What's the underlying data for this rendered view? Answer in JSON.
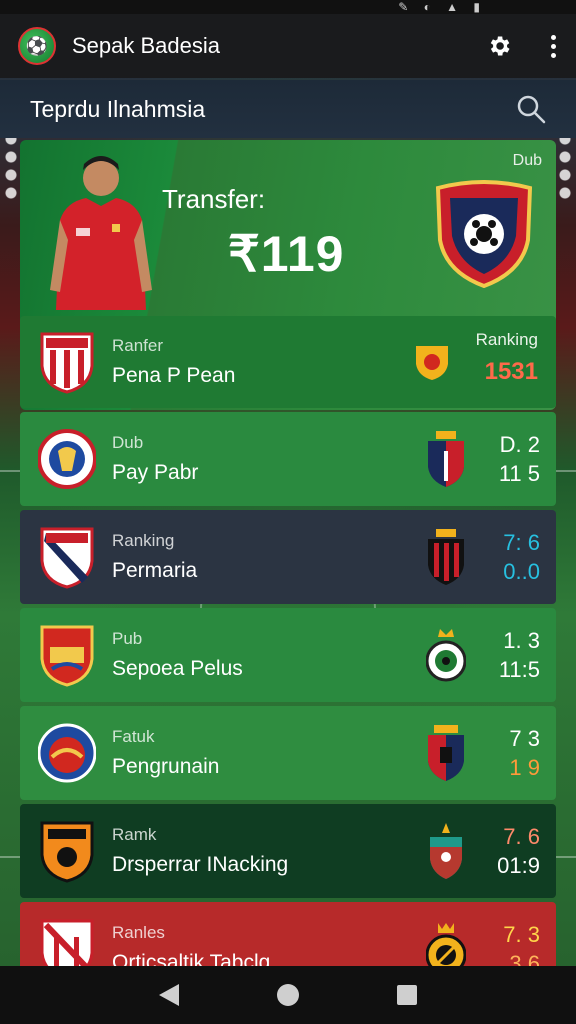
{
  "app": {
    "title": "Sepak Badesia",
    "logo_icon": "app-logo-icon"
  },
  "search": {
    "title": "Teprdu Ilnahmsia",
    "icon": "search-icon"
  },
  "hero": {
    "label": "Transfer:",
    "value": "₹119",
    "corner": "Dub",
    "player_icon": "player-photo",
    "crest_icon": "club-crest"
  },
  "rows": [
    {
      "sub": "Ranfer",
      "name": "Pena P Pean",
      "rank_head": "Ranking",
      "rank_val": "1531",
      "bg": "#1f7a33"
    },
    {
      "sub": "Dub",
      "name": "Pay Pabr",
      "stat1": "D. 2",
      "stat2": "11 5",
      "bg": "#2a8a3f",
      "stat_color1": "#ffffff",
      "stat_color2": "#ffffff"
    },
    {
      "sub": "Ranking",
      "name": "Permaria",
      "stat1": "7: 6",
      "stat2": "0..0",
      "bg": "#2b3442",
      "stat_color1": "#27c0e0",
      "stat_color2": "#27c0e0"
    },
    {
      "sub": "Pub",
      "name": "Sepoea Pelus",
      "stat1": "1. 3",
      "stat2": "11:5",
      "bg": "#2a8a3f",
      "stat_color1": "#ffffff",
      "stat_color2": "#ffffff"
    },
    {
      "sub": "Fatuk",
      "name": "Pengrunain",
      "stat1": "7 3",
      "stat2": "1 9",
      "bg": "#2f8d40",
      "stat_color1": "#ffffff",
      "stat_color2": "#ff9a3a"
    },
    {
      "sub": "Ramk",
      "name": "Drsperrar INacking",
      "stat1": "7. 6",
      "stat2": "01:9",
      "bg": "#0f3d22",
      "stat_color1": "#ff8a6a",
      "stat_color2": "#ffffff"
    },
    {
      "sub": "Ranles",
      "name": "Orticsaltik Tabclg",
      "stat1": "7. 3",
      "stat2": "3 6",
      "bg": "#b72a2a",
      "stat_color1": "#ffd54a",
      "stat_color2": "#ffb45a"
    }
  ],
  "status": {
    "icons": "✎ ◐ ▲ ▮"
  },
  "nav": {
    "back": "back-icon",
    "home": "home-icon",
    "recents": "recents-icon"
  }
}
